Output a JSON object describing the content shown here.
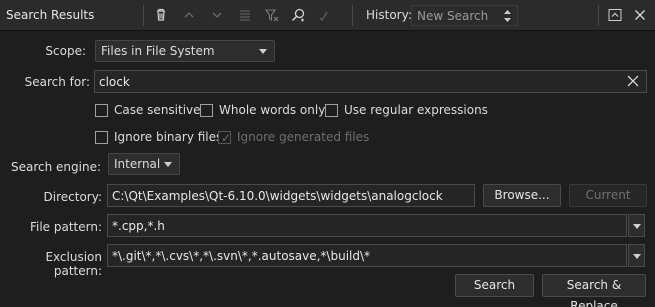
{
  "titlebar": {
    "title": "Search Results",
    "history_label": "History:",
    "history_value": "New Search",
    "icons": [
      "trash-icon",
      "up-arrow-icon",
      "down-arrow-icon",
      "list-icon",
      "filter-icon",
      "search-icon",
      "checkmark-icon",
      "chevron-up-icon",
      "close-icon"
    ]
  },
  "scope": {
    "label": "Scope:",
    "value": "Files in File System"
  },
  "search_for": {
    "label": "Search for:",
    "value": "clock"
  },
  "options": {
    "case_sensitive": "Case sensitive",
    "whole_words": "Whole words only",
    "regex": "Use regular expressions",
    "ignore_binary": "Ignore binary files",
    "ignore_generated": "Ignore generated files"
  },
  "engine": {
    "label": "Search engine:",
    "value": "Internal"
  },
  "directory": {
    "label": "Directory:",
    "value": "C:\\Qt\\Examples\\Qt-6.10.0\\widgets\\widgets\\analogclock",
    "browse": "Browse...",
    "current": "Current"
  },
  "file_pattern": {
    "label": "File pattern:",
    "value": "*.cpp,*.h"
  },
  "exclusion_pattern": {
    "label": "Exclusion pattern:",
    "value": "*\\.git\\*,*\\.cvs\\*,*\\.svn\\*,*.autosave,*\\build\\*"
  },
  "actions": {
    "search": "Search",
    "search_replace": "Search & Replace"
  },
  "colors": {
    "background": "#1e1e1e",
    "titlebar": "#2b2b2b",
    "border": "#4a4a4a"
  }
}
